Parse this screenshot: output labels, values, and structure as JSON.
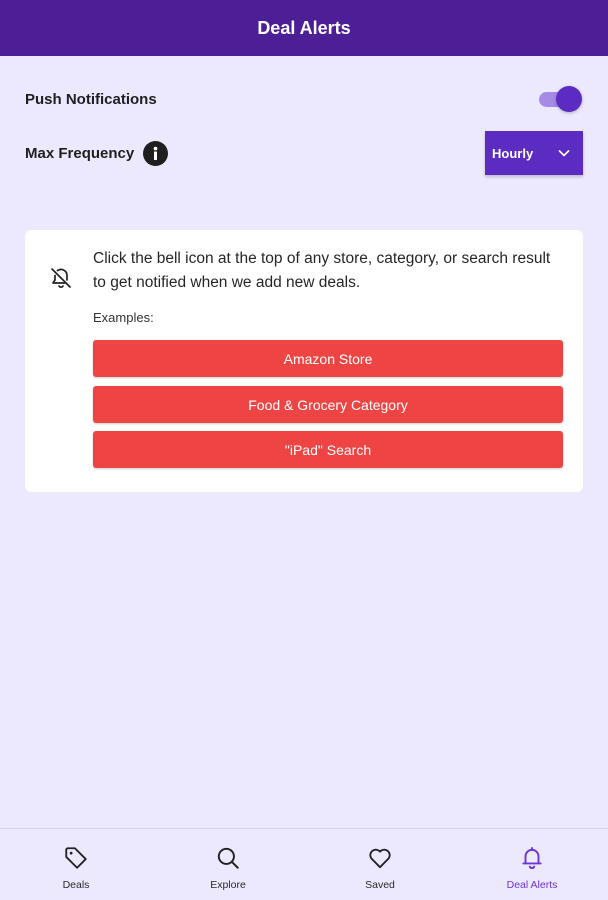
{
  "app_bar": {
    "title": "Deal Alerts"
  },
  "settings": {
    "push_notifications": {
      "label": "Push Notifications",
      "enabled": true
    },
    "max_frequency": {
      "label": "Max Frequency",
      "icon": "info-icon",
      "selected": "Hourly"
    }
  },
  "info_card": {
    "icon": "bell-off-icon",
    "text": "Click the bell icon at the top of any store, category, or search result to get notified when we add new deals.",
    "examples_label": "Examples:",
    "examples": [
      "Amazon Store",
      "Food & Grocery Category",
      "\"iPad\" Search"
    ]
  },
  "bottom_nav": {
    "items": [
      {
        "label": "Deals",
        "icon": "tag-icon",
        "active": false
      },
      {
        "label": "Explore",
        "icon": "search-icon",
        "active": false
      },
      {
        "label": "Saved",
        "icon": "heart-icon",
        "active": false
      },
      {
        "label": "Deal Alerts",
        "icon": "bell-icon",
        "active": true
      }
    ]
  },
  "colors": {
    "app_bar": "#4c1f97",
    "accent": "#5b2bc2",
    "background": "#ece8fd",
    "example_button": "#ef4444"
  }
}
